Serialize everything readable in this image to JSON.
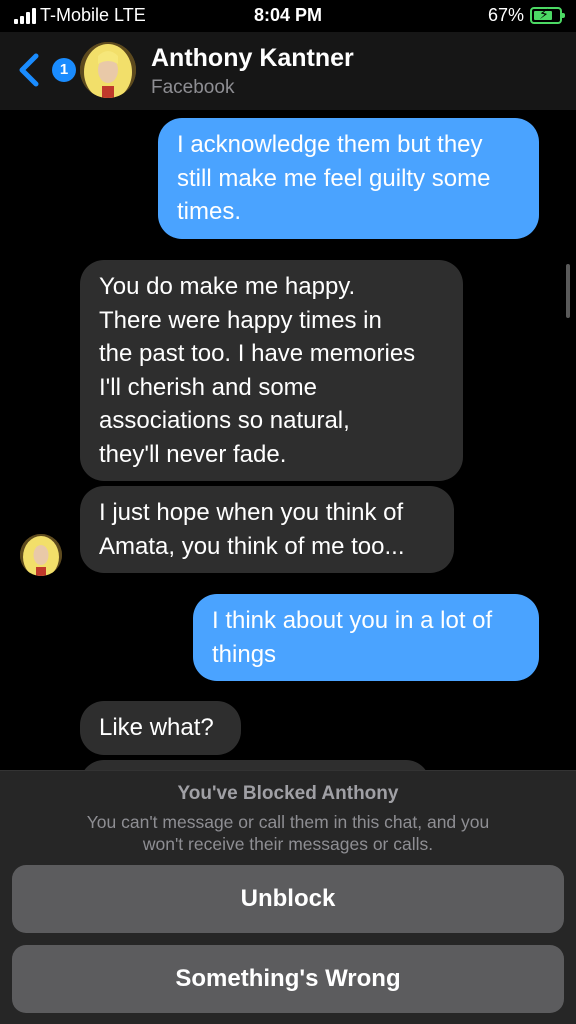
{
  "status_bar": {
    "carrier": "T-Mobile LTE",
    "time": "8:04 PM",
    "battery": "67%",
    "battery_level": 0.67,
    "battery_color": "#4cd964"
  },
  "header": {
    "back_badge": "1",
    "contact_name": "Anthony Kantner",
    "contact_subtitle": "Facebook",
    "accent_color": "#1a8cff"
  },
  "messages": [
    {
      "sender": "me",
      "lines": [
        "I acknowledge them but they",
        "still make me feel guilty some",
        "times."
      ]
    },
    {
      "sender": "them",
      "lines": [
        "You do make me happy.",
        "There were happy times in",
        "the past too. I have memories",
        "I'll cherish and some",
        "associations so natural,",
        "they'll never fade."
      ]
    },
    {
      "sender": "them",
      "lines": [
        "I just hope when you think of",
        "Amata, you think of me too..."
      ]
    },
    {
      "sender": "me",
      "lines": [
        "I think about you in a lot of",
        "things"
      ]
    },
    {
      "sender": "them",
      "lines": [
        "Like what?"
      ]
    }
  ],
  "blocked": {
    "title": "You've Blocked Anthony",
    "description_lines": [
      "You can't message or call them in this chat, and you",
      "won't receive their messages or calls."
    ],
    "unblock_label": "Unblock",
    "something_wrong_label": "Something's Wrong"
  },
  "colors": {
    "sent_bubble": "#4aa3ff",
    "received_bubble": "#2e2e2e",
    "background": "#000000"
  },
  "icons": [
    "signal-icon",
    "battery-icon",
    "back-chevron-icon",
    "avatar"
  ]
}
